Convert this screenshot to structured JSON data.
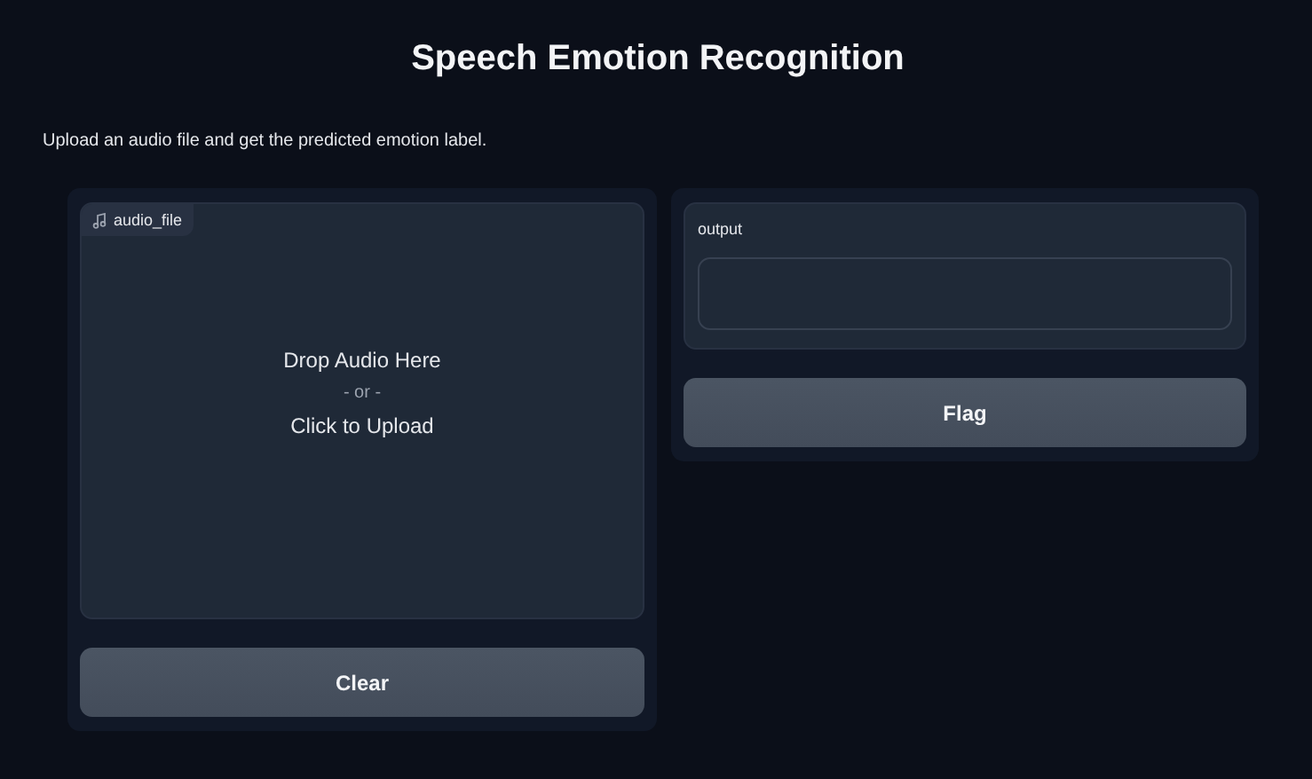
{
  "title": "Speech Emotion Recognition",
  "description": "Upload an audio file and get the predicted emotion label.",
  "input": {
    "label": "audio_file",
    "drop_text": "Drop Audio Here",
    "or_text": "- or -",
    "click_text": "Click to Upload"
  },
  "clear_button": "Clear",
  "output": {
    "label": "output"
  },
  "flag_button": "Flag"
}
